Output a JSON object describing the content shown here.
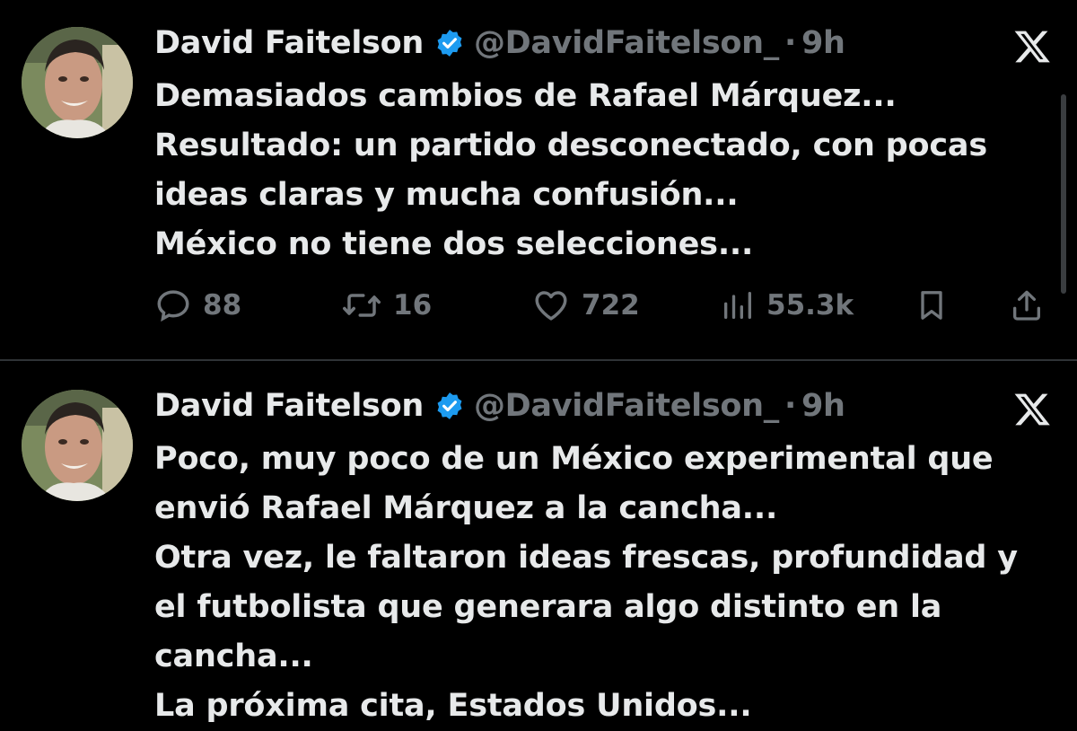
{
  "tweets": [
    {
      "author": {
        "name": "David Faitelson",
        "handle": "@DavidFaitelson_",
        "verified": true
      },
      "separator": "·",
      "time": "9h",
      "lines": [
        "Demasiados cambios de Rafael Márquez...",
        "Resultado: un partido desconectado, con pocas",
        "ideas claras y mucha confusión...",
        "México no tiene dos selecciones..."
      ],
      "stats": {
        "replies": "88",
        "reposts": "16",
        "likes": "722",
        "views": "55.3k"
      }
    },
    {
      "author": {
        "name": "David Faitelson",
        "handle": "@DavidFaitelson_",
        "verified": true
      },
      "separator": "·",
      "time": "9h",
      "lines": [
        "Poco, muy poco de un México experimental que",
        "envió Rafael Márquez a la cancha...",
        "Otra vez, le faltaron ideas frescas, profundidad y",
        "el futbolista que generara algo distinto en la",
        "cancha...",
        "La próxima cita, Estados Unidos..."
      ]
    }
  ],
  "colors": {
    "background": "#000000",
    "text_primary": "#e7e9ea",
    "text_secondary": "#71767b",
    "verified_badge": "#1d9bf0",
    "divider": "#2f3336"
  },
  "icons": {
    "reply": "speech-bubble-icon",
    "repost": "repost-arrows-icon",
    "like": "heart-icon",
    "views": "bar-chart-icon",
    "bookmark": "bookmark-icon",
    "share": "share-upload-icon",
    "brand": "x-logo-icon",
    "verified": "verified-badge-icon"
  }
}
